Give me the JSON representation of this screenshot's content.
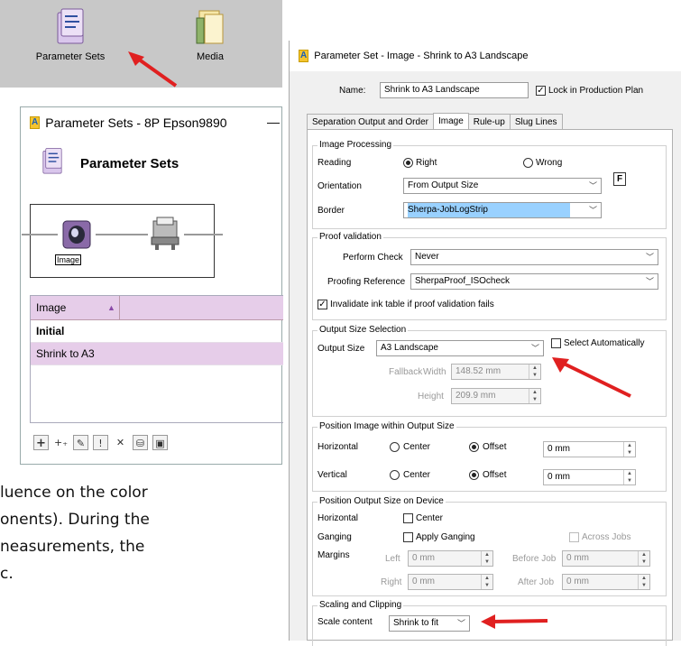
{
  "toolbar": {
    "items": [
      {
        "label": "Parameter Sets",
        "icon": "parameter-sets-icon"
      },
      {
        "label": "Media",
        "icon": "media-icon"
      }
    ]
  },
  "background_text": {
    "line1": "luence on the color",
    "line2": "onents). During the",
    "line3": "neasurements, the",
    "line4": "c."
  },
  "left_window": {
    "title": "Parameter Sets - 8P Epson9890",
    "app_badge": "A",
    "header": "Parameter Sets",
    "flow_node_label": "Image",
    "list": {
      "column": "Image",
      "rows": [
        "Initial",
        "Shrink to A3"
      ]
    },
    "buttons": [
      "+",
      "+₊",
      "✎",
      "!",
      "✕",
      "⛁",
      "▣"
    ]
  },
  "right_window": {
    "title": "Parameter Set - Image - Shrink to A3 Landscape",
    "app_badge": "A",
    "name_label": "Name:",
    "name_value": "Shrink to A3 Landscape",
    "lock_label": "Lock in Production Plan",
    "tabs": [
      "Separation Output and Order",
      "Image",
      "Rule-up",
      "Slug Lines"
    ],
    "image_processing": {
      "title": "Image Processing",
      "reading_label": "Reading",
      "right_label": "Right",
      "wrong_label": "Wrong",
      "orientation_label": "Orientation",
      "orientation_value": "From Output Size",
      "f_badge": "F",
      "border_label": "Border",
      "border_value": "Sherpa-JobLogStrip"
    },
    "proof_validation": {
      "title": "Proof validation",
      "perform_label": "Perform Check",
      "perform_value": "Never",
      "reference_label": "Proofing Reference",
      "reference_value": "SherpaProof_ISOcheck",
      "invalidate_label": "Invalidate ink table if proof validation fails"
    },
    "output_size": {
      "title": "Output Size Selection",
      "size_label": "Output Size",
      "size_value": "A3 Landscape",
      "select_auto_label": "Select Automatically",
      "fallback_label": "Fallback",
      "width_label": "Width",
      "width_value": "148.52 mm",
      "height_label": "Height",
      "height_value": "209.9 mm"
    },
    "position_image": {
      "title": "Position Image within Output Size",
      "horizontal_label": "Horizontal",
      "vertical_label": "Vertical",
      "center_label": "Center",
      "offset_label": "Offset",
      "h_value": "0 mm",
      "v_value": "0 mm"
    },
    "position_device": {
      "title": "Position Output Size on Device",
      "horizontal_label": "Horizontal",
      "center_label": "Center",
      "ganging_label": "Ganging",
      "apply_ganging_label": "Apply Ganging",
      "across_jobs_label": "Across Jobs",
      "margins_label": "Margins",
      "left_label": "Left",
      "left_value": "0 mm",
      "before_label": "Before Job",
      "before_value": "0 mm",
      "right_label": "Right",
      "right_value": "0 mm",
      "after_label": "After Job",
      "after_value": "0 mm"
    },
    "scaling": {
      "title": "Scaling and Clipping",
      "scale_label": "Scale content",
      "scale_value": "Shrink to fit"
    }
  },
  "colors": {
    "toolbar_bg": "#c8c8c8",
    "list_highlight": "#e6cde9",
    "border_highlight": "#99d1ff",
    "annotation_arrow": "#e02020"
  }
}
